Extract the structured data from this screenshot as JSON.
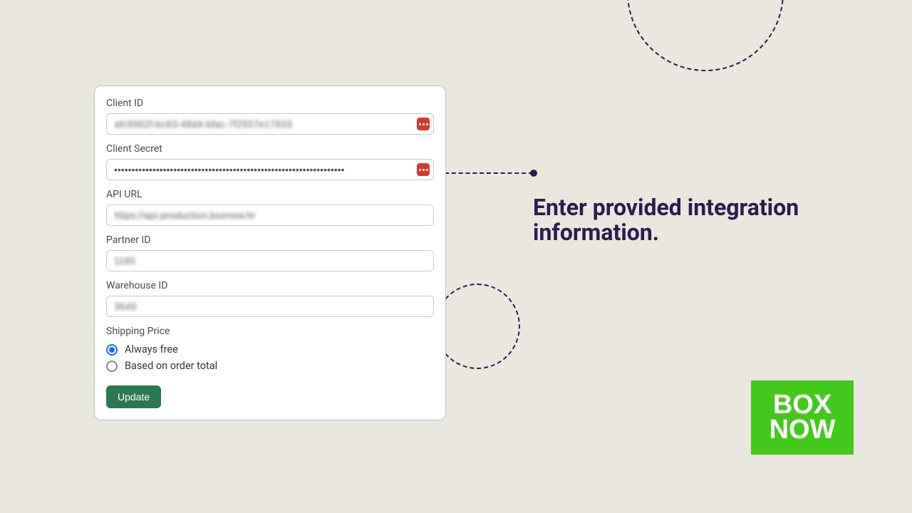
{
  "instruction": "Enter provided integration information.",
  "logo": {
    "line1": "BOX",
    "line2": "NOW"
  },
  "form": {
    "client_id": {
      "label": "Client ID",
      "value": "afc9962f-bc83-48d4-bfac-7f2557e17833"
    },
    "client_secret": {
      "label": "Client Secret",
      "value": "••••••••••••••••••••••••••••••••••••••••••••••••••••••••••••••••••"
    },
    "api_url": {
      "label": "API URL",
      "value": "https://api-production.boxnow.hr"
    },
    "partner_id": {
      "label": "Partner ID",
      "value": "1185"
    },
    "warehouse_id": {
      "label": "Warehouse ID",
      "value": "3649"
    },
    "shipping_price": {
      "label": "Shipping Price",
      "options": [
        {
          "label": "Always free",
          "checked": true
        },
        {
          "label": "Based on order total",
          "checked": false
        }
      ]
    },
    "submit_label": "Update"
  }
}
